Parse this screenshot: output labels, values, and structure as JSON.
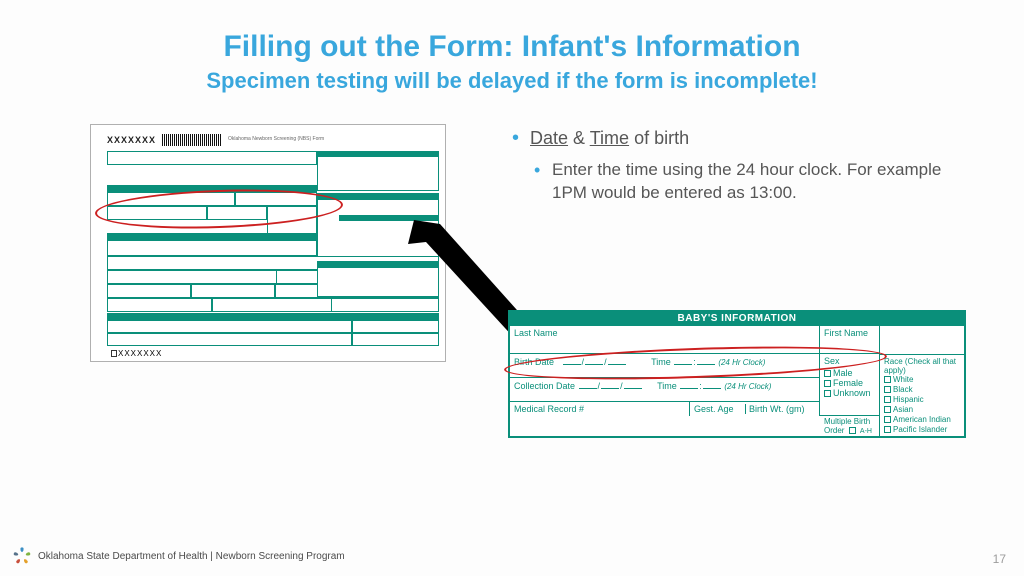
{
  "slide": {
    "title": "Filling out the Form: Infant's Information",
    "subtitle": "Specimen testing will be delayed if the form is incomplete!",
    "page_number": "17"
  },
  "bullets": {
    "item1_part1": "Date",
    "item1_amp": " & ",
    "item1_part2": "Time",
    "item1_tail": " of birth",
    "item2": "Enter the time using the 24 hour clock. For example 1PM would be entered as 13:00."
  },
  "thumb": {
    "code": "XXXXXXX",
    "form_title": "Oklahoma Newborn Screening (NBS) Form",
    "bottom_code": "XXXXXXX"
  },
  "detail": {
    "header": "BABY'S INFORMATION",
    "last_name": "Last Name",
    "first_name": "First Name",
    "birth_date": "Birth Date",
    "time": "Time",
    "clock_hint": "(24 Hr Clock)",
    "collection_date": "Collection Date",
    "medical_record": "Medical Record #",
    "gest_age": "Gest. Age",
    "birth_wt": "Birth Wt. (gm)",
    "multiple_birth": "Multiple Birth Order",
    "ah": "A-H",
    "sex_label": "Sex",
    "sex_opts": [
      "Male",
      "Female",
      "Unknown"
    ],
    "race_label": "Race (Check all that apply)",
    "race_opts": [
      "White",
      "Black",
      "Hispanic",
      "Asian",
      "American Indian",
      "Pacific Islander"
    ]
  },
  "footer": {
    "org": "Oklahoma State Department of Health | Newborn Screening Program"
  }
}
